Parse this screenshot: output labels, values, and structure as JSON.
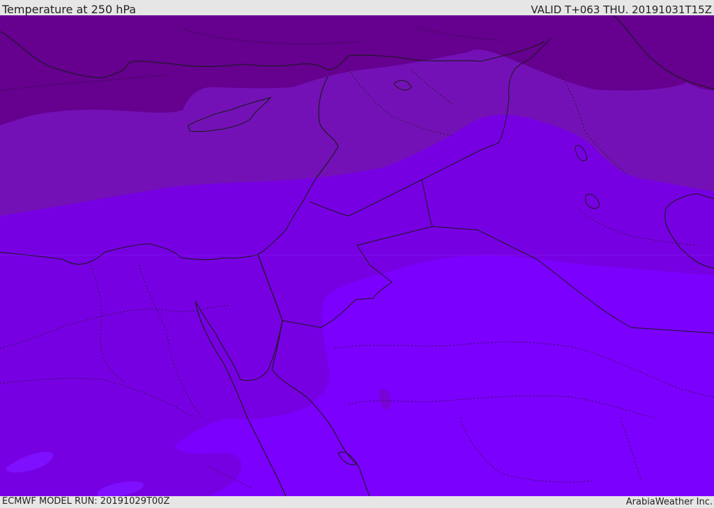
{
  "header": {
    "title": "Temperature at 250 hPa",
    "valid": "VALID T+063 THU. 20191031T15Z"
  },
  "footer": {
    "model_run": "ECMWF MODEL RUN: 20191029T00Z",
    "credit": "ArabiaWeather Inc."
  },
  "colors": {
    "band_coldest": "#65008f",
    "band_cold": "#7311b6",
    "band_mid": "#7700e3",
    "band_warm": "#7c00fe",
    "band_warmest": "#7f10ff",
    "borders": "#1a1a1a"
  }
}
